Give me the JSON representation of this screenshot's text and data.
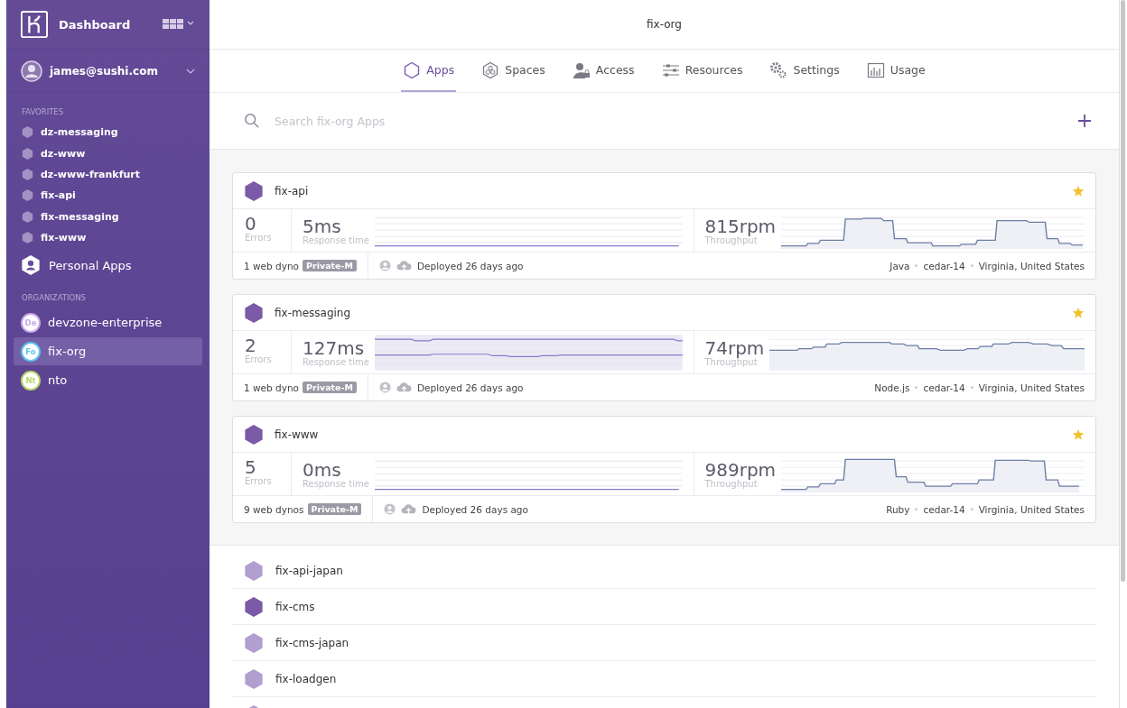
{
  "sidebar": {
    "title": "Dashboard",
    "account": "james@sushi.com",
    "favorites_heading": "FAVORITES",
    "favorites": [
      "dz-messaging",
      "dz-www",
      "dz-www-frankfurt",
      "fix-api",
      "fix-messaging",
      "fix-www"
    ],
    "personal_apps": "Personal Apps",
    "organizations_heading": "ORGANIZATIONS",
    "organizations": [
      {
        "initials": "De",
        "name": "devzone-enterprise",
        "color": "#c9a9e6",
        "selected": false
      },
      {
        "initials": "Fo",
        "name": "fix-org",
        "color": "#5fc3ee",
        "selected": true
      },
      {
        "initials": "Nt",
        "name": "nto",
        "color": "#b6d96a",
        "selected": false
      }
    ]
  },
  "header": {
    "title": "fix-org"
  },
  "tabs": [
    {
      "label": "Apps",
      "selected": true
    },
    {
      "label": "Spaces",
      "selected": false
    },
    {
      "label": "Access",
      "selected": false
    },
    {
      "label": "Resources",
      "selected": false
    },
    {
      "label": "Settings",
      "selected": false
    },
    {
      "label": "Usage",
      "selected": false
    }
  ],
  "search": {
    "placeholder": "Search fix-org Apps"
  },
  "cards": [
    {
      "name": "fix-api",
      "starred": true,
      "errors": "0",
      "errors_label": "Errors",
      "response": "5ms",
      "response_label": "Response time",
      "throughput": "815rpm",
      "throughput_label": "Throughput",
      "dynos": "1 web dyno",
      "size": "Private-M",
      "deployed": "Deployed 26 days ago",
      "meta": [
        "Java",
        "cedar-14",
        "Virginia, United States"
      ]
    },
    {
      "name": "fix-messaging",
      "starred": true,
      "errors": "2",
      "errors_label": "Errors",
      "response": "127ms",
      "response_label": "Response time",
      "throughput": "74rpm",
      "throughput_label": "Throughput",
      "dynos": "1 web dyno",
      "size": "Private-M",
      "deployed": "Deployed 26 days ago",
      "meta": [
        "Node.js",
        "cedar-14",
        "Virginia, United States"
      ]
    },
    {
      "name": "fix-www",
      "starred": true,
      "errors": "5",
      "errors_label": "Errors",
      "response": "0ms",
      "response_label": "Response time",
      "throughput": "989rpm",
      "throughput_label": "Throughput",
      "dynos": "9 web dynos",
      "size": "Private-M",
      "deployed": "Deployed 26 days ago",
      "meta": [
        "Ruby",
        "cedar-14",
        "Virginia, United States"
      ]
    }
  ],
  "apps": [
    {
      "name": "fix-api-japan",
      "color": "#b39ed0"
    },
    {
      "name": "fix-cms",
      "color": "#7b5aa6"
    },
    {
      "name": "fix-cms-japan",
      "color": "#b39ed0"
    },
    {
      "name": "fix-loadgen",
      "color": "#b39ed0"
    }
  ]
}
